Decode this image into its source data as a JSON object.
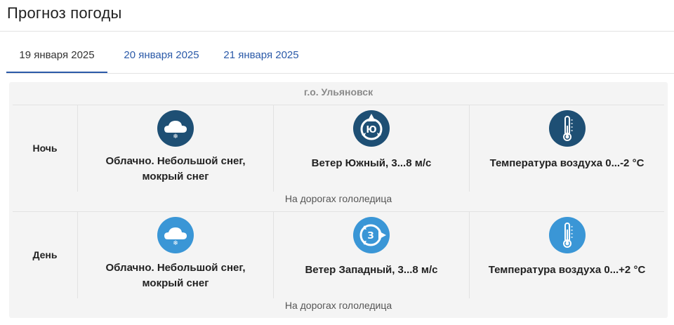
{
  "page": {
    "title": "Прогноз погоды"
  },
  "tabs": [
    {
      "label": "19 января 2025",
      "active": true
    },
    {
      "label": "20 января 2025",
      "active": false
    },
    {
      "label": "21 января 2025",
      "active": false
    }
  ],
  "forecast": {
    "city": "г.о. Ульяновск",
    "rows": [
      {
        "period": "Ночь",
        "condition": "Облачно. Небольшой снег, мокрый снег",
        "condition_line1": "Облачно. Небольшой снег,",
        "condition_line2": "мокрый снег",
        "wind": "Ветер Южный, 3...8 м/с",
        "wind_letter": "Ю",
        "temperature": "Температура воздуха 0...-2 °С",
        "road": "На дорогах гололедица",
        "icon_color": "#1e4f74",
        "icons": {
          "weather": "cloud-snow-icon",
          "wind": "compass-icon",
          "temperature": "thermometer-icon"
        }
      },
      {
        "period": "День",
        "condition": "Облачно. Небольшой снег, мокрый снег",
        "condition_line1": "Облачно. Небольшой снег,",
        "condition_line2": "мокрый снег",
        "wind": "Ветер Западный, 3...8 м/с",
        "wind_letter": "З",
        "temperature": "Температура воздуха 0...+2 °С",
        "road": "На дорогах гололедица",
        "icon_color": "#3a96d6",
        "icons": {
          "weather": "cloud-snow-icon",
          "wind": "compass-icon",
          "temperature": "thermometer-icon"
        }
      }
    ]
  },
  "colors": {
    "accent": "#2b5aa8",
    "night_icon": "#1e4f74",
    "day_icon": "#3a96d6",
    "card_bg": "#f4f4f4"
  }
}
